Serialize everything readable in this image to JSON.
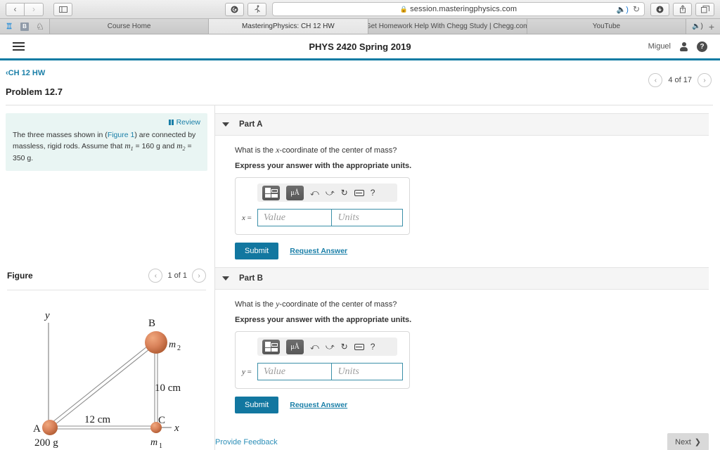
{
  "browser": {
    "back_icon": "chevron-left",
    "forward_icon": "chevron-right",
    "sidebar_icon": "sidebar",
    "grammarly_icon": "G",
    "extension_icon": "person-running",
    "url": "session.masteringphysics.com",
    "lock_icon": "lock",
    "audio_icon": "speaker",
    "reload_icon": "reload",
    "download_icon": "download",
    "share_icon": "share",
    "tabs_icon": "tab-overview",
    "favorites": [
      {
        "name": "weebly-bookmark",
        "glyph": "W"
      },
      {
        "name": "blue-bookmark",
        "glyph": "B"
      },
      {
        "name": "crest-bookmark",
        "glyph": "♜"
      }
    ],
    "tabs": [
      {
        "title": "Course Home",
        "active": false
      },
      {
        "title": "MasteringPhysics: CH 12 HW",
        "active": true
      },
      {
        "title": "Get Homework Help With Chegg Study | Chegg.com",
        "active": false
      },
      {
        "title": "YouTube",
        "active": false
      }
    ],
    "new_tab_glyph": "+"
  },
  "header": {
    "menu_icon": "hamburger-menu",
    "title": "PHYS 2420 Spring 2019",
    "user_name": "Miguel",
    "account_icon": "person-icon",
    "help_icon": "question-mark-icon",
    "accent_color": "#0d7ba3"
  },
  "breadcrumb": {
    "back_glyph": "‹",
    "label": "CH 12 HW"
  },
  "problem": {
    "title": "Problem 12.7",
    "pager": {
      "prev_icon": "chevron-left",
      "label": "4 of 17",
      "next_icon": "chevron-right"
    }
  },
  "statement": {
    "review_label": "Review",
    "review_icon": "book-icon",
    "text_before": "The three masses shown in (",
    "figure_link": "Figure 1",
    "text_mid": ") are connected by massless, rigid rods. Assume that ",
    "m1_var": "m",
    "m1_sub": "1",
    "m1_value": " = 160 g and ",
    "m2_var": "m",
    "m2_sub": "2",
    "m2_value": " = 350 g.",
    "background_color": "#e9f5f3"
  },
  "figure": {
    "title": "Figure",
    "pager": {
      "prev_icon": "chevron-left",
      "label": "1 of 1",
      "next_icon": "chevron-right"
    },
    "axis_y_label": "y",
    "axis_x_label": "x",
    "point_a_label": "A",
    "point_a_mass": "200 g",
    "point_b_label": "B",
    "point_b_mass_var": "m",
    "point_b_mass_sub": "2",
    "point_c_label": "C",
    "point_c_mass_var": "m",
    "point_c_mass_sub": "1",
    "dim_horizontal": "12 cm",
    "dim_vertical": "10 cm",
    "ball_color": "#d0764a"
  },
  "parts": [
    {
      "caret_icon": "caret-down-icon",
      "label": "Part A",
      "question_pre": "What is the ",
      "question_var": "x",
      "question_post": "-coordinate of the center of mass?",
      "express": "Express your answer with the appropriate units.",
      "var_label": "x",
      "var_eq": " =",
      "value_placeholder": "Value",
      "units_placeholder": "Units",
      "submit_label": "Submit",
      "request_label": "Request Answer",
      "toolbar": [
        {
          "name": "template-icon",
          "glyph": "template"
        },
        {
          "name": "units-icon",
          "glyph": "μÅ"
        },
        {
          "name": "undo-icon",
          "glyph": "↶"
        },
        {
          "name": "redo-icon",
          "glyph": "↷"
        },
        {
          "name": "reset-icon",
          "glyph": "↺"
        },
        {
          "name": "keyboard-icon",
          "glyph": "keyboard"
        },
        {
          "name": "help-icon",
          "glyph": "?"
        }
      ]
    },
    {
      "caret_icon": "caret-down-icon",
      "label": "Part B",
      "question_pre": "What is the ",
      "question_var": "y",
      "question_post": "-coordinate of the center of mass?",
      "express": "Express your answer with the appropriate units.",
      "var_label": "y",
      "var_eq": " =",
      "value_placeholder": "Value",
      "units_placeholder": "Units",
      "submit_label": "Submit",
      "request_label": "Request Answer",
      "toolbar": [
        {
          "name": "template-icon",
          "glyph": "template"
        },
        {
          "name": "units-icon",
          "glyph": "μÅ"
        },
        {
          "name": "undo-icon",
          "glyph": "↶"
        },
        {
          "name": "redo-icon",
          "glyph": "↷"
        },
        {
          "name": "reset-icon",
          "glyph": "↺"
        },
        {
          "name": "keyboard-icon",
          "glyph": "keyboard"
        },
        {
          "name": "help-icon",
          "glyph": "?"
        }
      ]
    }
  ],
  "footer": {
    "feedback_label": "Provide Feedback",
    "next_label": "Next",
    "next_icon": "chevron-right"
  }
}
